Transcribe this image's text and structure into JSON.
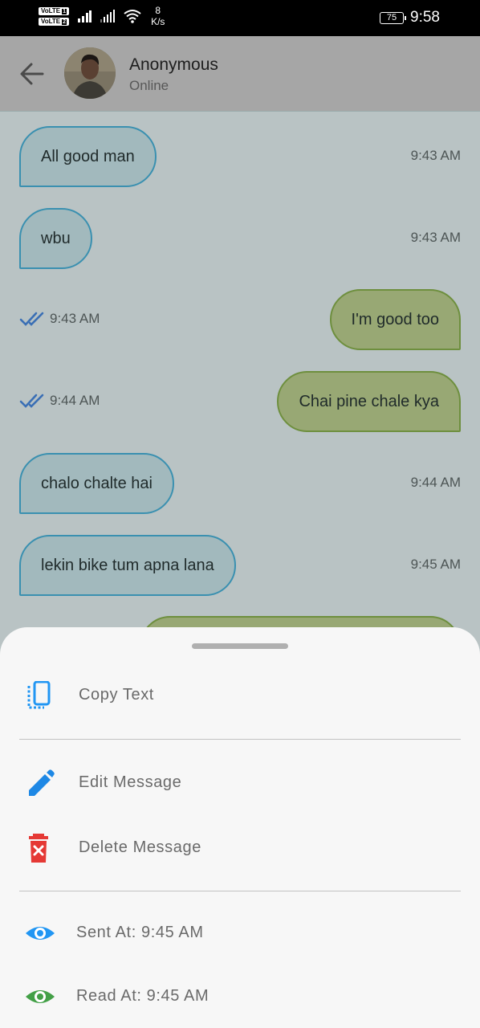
{
  "status_bar": {
    "sim1": "VoLTE",
    "sim1_num": "1",
    "sim2": "VoLTE",
    "sim2_num": "2",
    "speed_value": "8",
    "speed_unit": "K/s",
    "battery": "75",
    "time": "9:58"
  },
  "header": {
    "name": "Anonymous",
    "status": "Online"
  },
  "messages": [
    {
      "text": "All good man",
      "time": "9:43 AM",
      "direction": "incoming"
    },
    {
      "text": "wbu",
      "time": "9:43 AM",
      "direction": "incoming"
    },
    {
      "text": "I'm good too",
      "time": "9:43 AM",
      "direction": "outgoing",
      "read": true
    },
    {
      "text": "Chai pine chale kya",
      "time": "9:44 AM",
      "direction": "outgoing",
      "read": true
    },
    {
      "text": "chalo chalte hai",
      "time": "9:44 AM",
      "direction": "incoming"
    },
    {
      "text": "lekin bike tum apna lana",
      "time": "9:45 AM",
      "direction": "incoming"
    }
  ],
  "sheet": {
    "copy_label": "Copy Text",
    "edit_label": "Edit Message",
    "delete_label": "Delete Message",
    "sent_label": "Sent At: 9:45 AM",
    "read_label": "Read At: 9:45 AM"
  },
  "colors": {
    "incoming_border": "#3a90b0",
    "outgoing_border": "#6e8f3e",
    "copy_icon": "#2196f3",
    "edit_icon": "#1e88e5",
    "delete_icon": "#e53935",
    "sent_icon": "#2196f3",
    "read_icon": "#43a047"
  },
  "icons": {
    "back": "arrow-left-icon",
    "copy": "copy-icon",
    "edit": "pencil-icon",
    "delete": "trash-icon",
    "sent": "eye-icon",
    "read": "eye-icon",
    "read_receipt": "double-check-icon"
  }
}
